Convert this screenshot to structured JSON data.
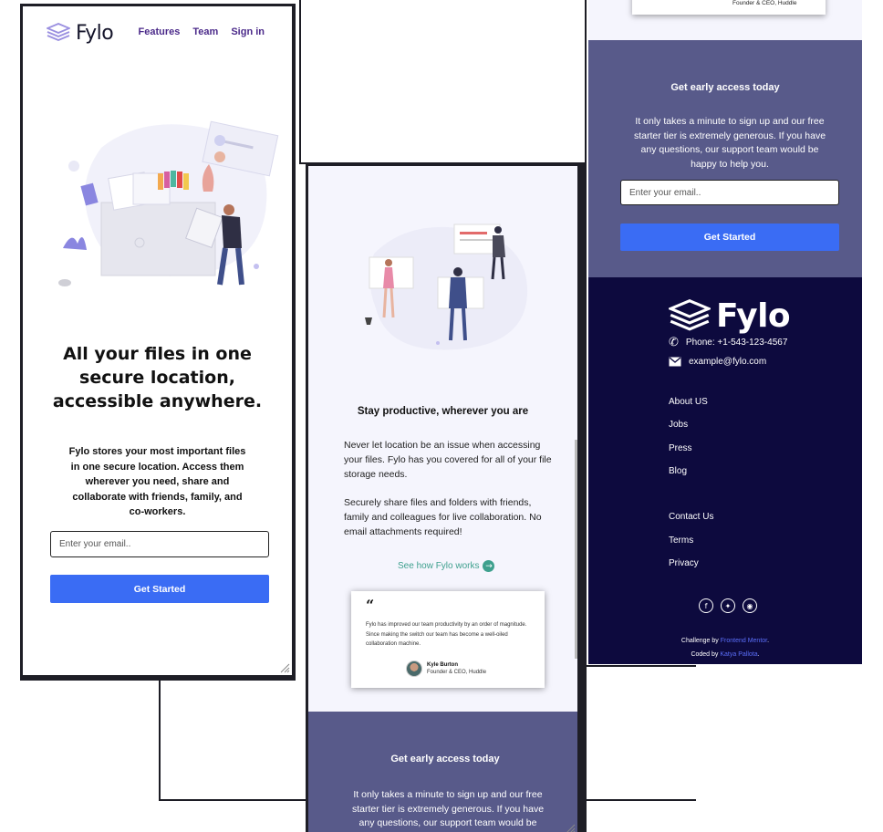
{
  "brand": {
    "name": "Fylo"
  },
  "nav": {
    "features": "Features",
    "team": "Team",
    "signin": "Sign in"
  },
  "hero": {
    "title_line1": "All your files in one",
    "title_line2": "secure location,",
    "title_line3": "accessible anywhere.",
    "description": "Fylo stores your most important files in one secure location. Access them wherever you need, share and collaborate with friends, family, and co-workers.",
    "email_placeholder": "Enter your email..",
    "cta": "Get Started"
  },
  "productive": {
    "title": "Stay productive, wherever you are",
    "para1": "Never let location be an issue when accessing your files. Fylo has you covered for all of your file storage needs.",
    "para2": "Securely share files and folders with friends, family and colleagues for live collaboration. No email attachments required!",
    "link": "See how Fylo works",
    "link_icon": "arrow-right-circle-icon"
  },
  "testimonial": {
    "quote_mark": "“",
    "text": "Fylo has improved our team productivity by an order of magnitude. Since making the switch our team has become a well-oiled collaboration machine.",
    "name": "Kyle Burton",
    "role": "Founder & CEO, Huddle"
  },
  "early_access": {
    "title": "Get early access today",
    "description": "It only takes a minute to sign up and our free starter tier is extremely generous. If you have any questions, our support team would be happy to help you.",
    "description_cut": "It only takes a minute to sign up and our free starter tier is extremely generous. If you have any questions, our support team would be",
    "email_placeholder": "Enter your email..",
    "cta": "Get Started"
  },
  "footer": {
    "phone": "Phone: +1-543-123-4567",
    "email": "example@fylo.com",
    "links_col1": [
      "About US",
      "Jobs",
      "Press",
      "Blog"
    ],
    "links_col2": [
      "Contact Us",
      "Terms",
      "Privacy"
    ],
    "social_icons": [
      "facebook-icon",
      "twitter-icon",
      "instagram-icon"
    ],
    "challenge_prefix": "Challenge by",
    "challenge_link": "Frontend Mentor",
    "coded_prefix": "Coded by",
    "coded_link": "Katya Pallota"
  },
  "colors": {
    "accent_blue": "#3a6cf4",
    "nav_purple": "#4b2a8a",
    "early_bg": "#585a8a",
    "footer_bg": "#0d0a3e",
    "teal_link": "#3ea08e",
    "light_bg": "#f5f5fd"
  }
}
